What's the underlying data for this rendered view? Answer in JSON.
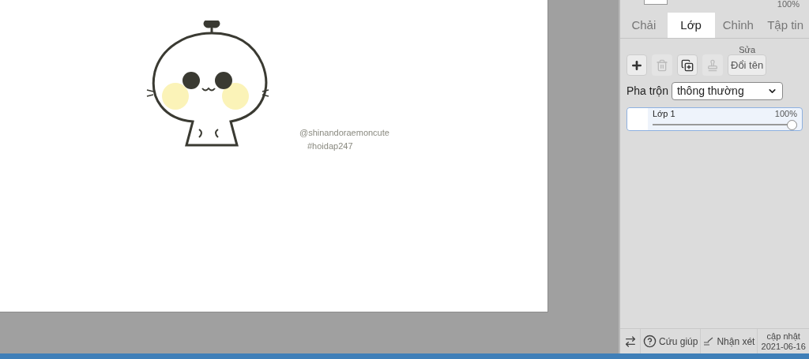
{
  "canvas": {
    "texts": [
      "@shinandoraemoncute",
      "#hoidap247"
    ]
  },
  "top_layer": {
    "opacity": "100%"
  },
  "tabs": [
    {
      "label": "Chải",
      "selected": false
    },
    {
      "label": "Lớp",
      "selected": true
    },
    {
      "label": "Chỉnh",
      "selected": false
    },
    {
      "label": "Tập tin",
      "selected": false
    }
  ],
  "toolbar": [
    {
      "kind": "add",
      "disabled": false
    },
    {
      "kind": "delete",
      "disabled": true
    },
    {
      "kind": "duplicate",
      "disabled": false
    },
    {
      "kind": "merge",
      "disabled": true
    }
  ],
  "rename_button": {
    "label": "Đổi tên",
    "tooltip": "Sửa"
  },
  "blend": {
    "label": "Pha trộn",
    "value": "thông thường"
  },
  "layers": [
    {
      "name": "Lớp 1",
      "opacity": "100%",
      "level": 1,
      "selected": true
    }
  ],
  "footer": {
    "help": "Cứu giúp",
    "feedback": "Nhận xét",
    "update_label": "cập nhật",
    "update_date": "2021-06-16"
  }
}
